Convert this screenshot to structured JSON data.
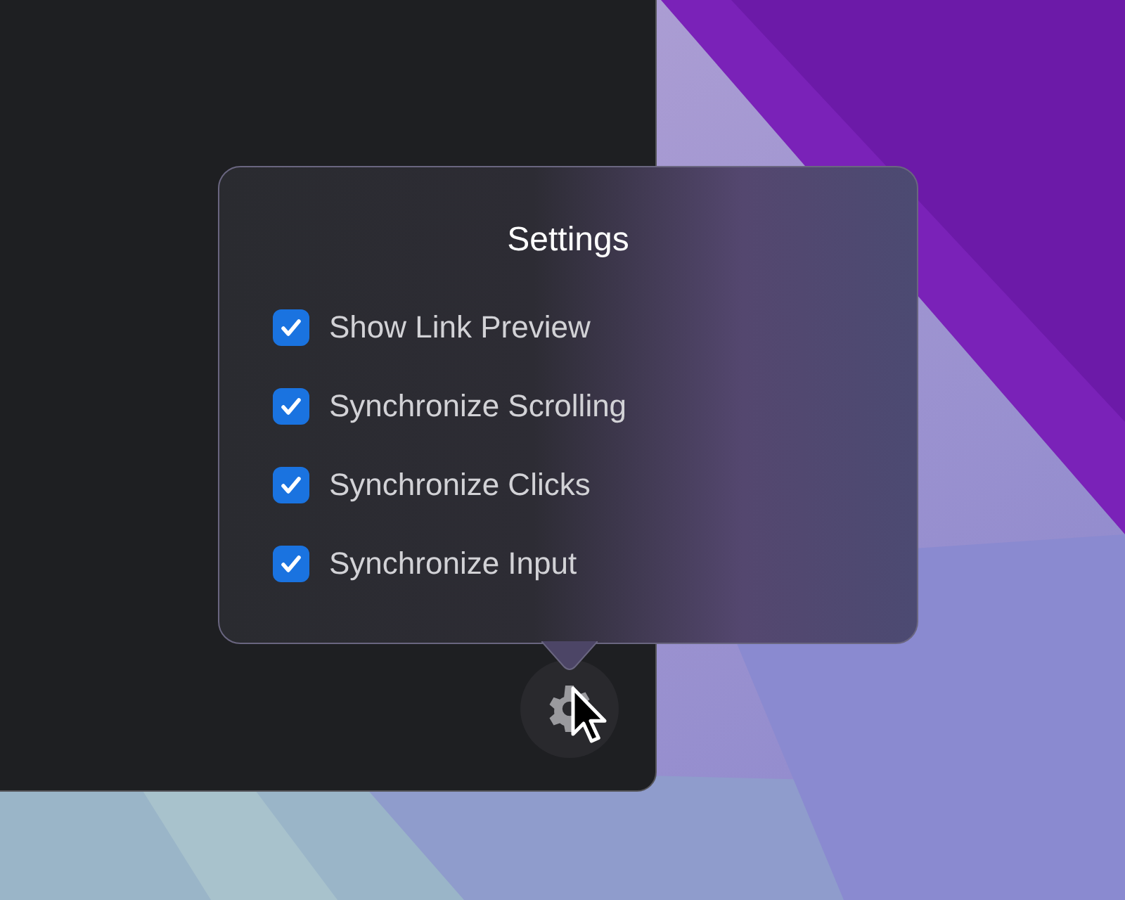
{
  "popover": {
    "title": "Settings",
    "options": [
      {
        "label": "Show Link Preview",
        "checked": true
      },
      {
        "label": "Synchronize Scrolling",
        "checked": true
      },
      {
        "label": "Synchronize Clicks",
        "checked": true
      },
      {
        "label": "Synchronize Input",
        "checked": true
      }
    ]
  }
}
